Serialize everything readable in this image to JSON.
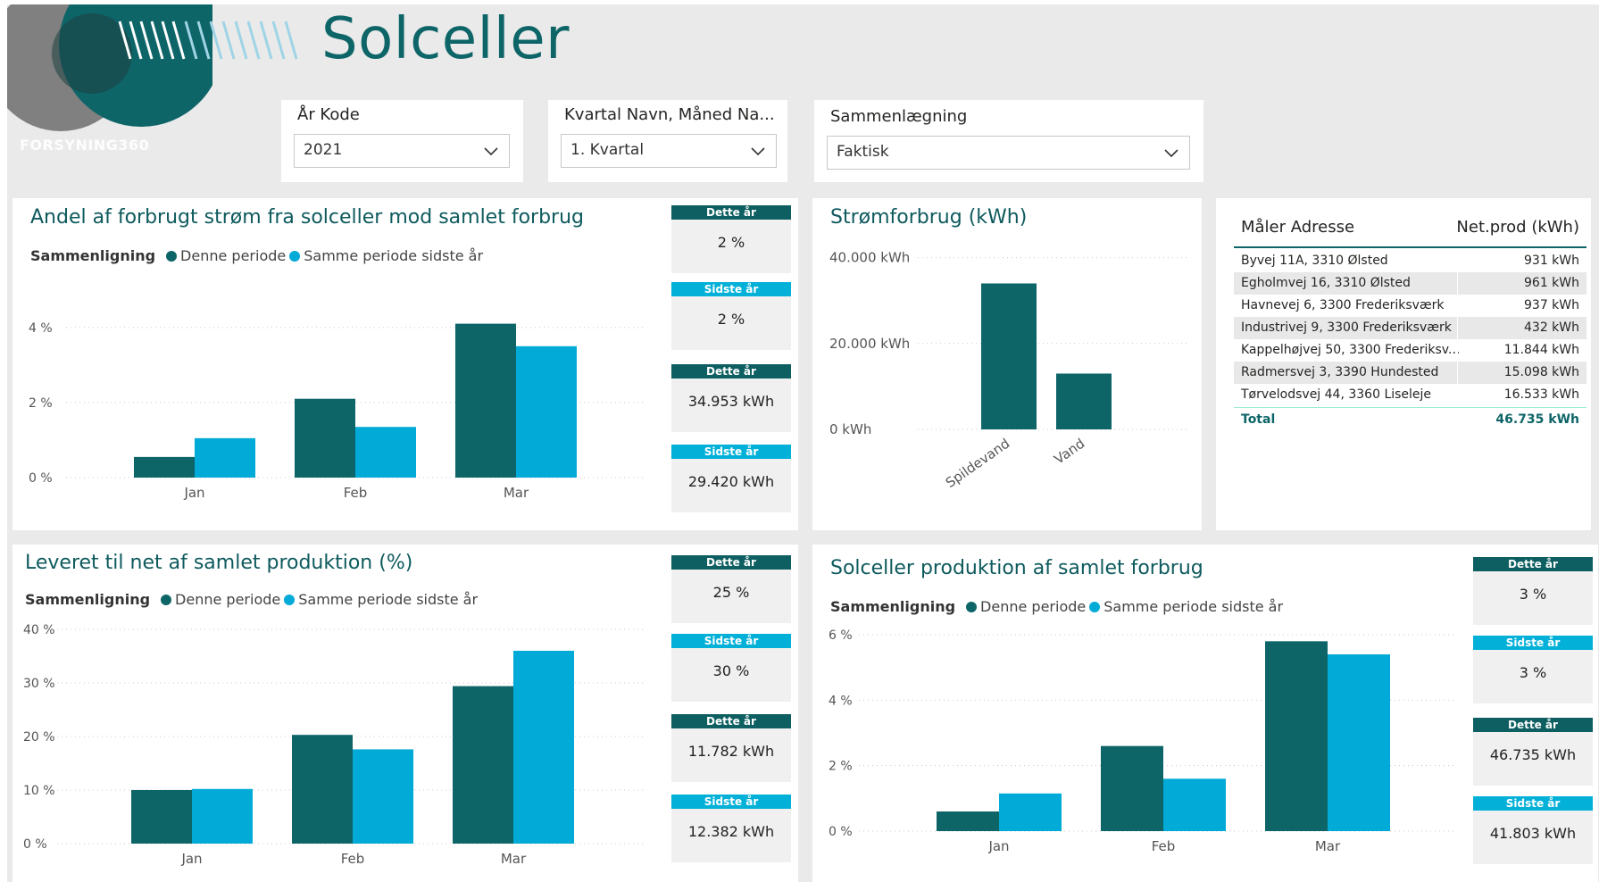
{
  "page": {
    "title": "Solceller",
    "logo_text": "FORSYNING360"
  },
  "colors": {
    "primary": "#0e6568",
    "secondary": "#01aad7",
    "kpi_dark": "#0e5f61",
    "kpi_light": "#02b0d8"
  },
  "slicers": [
    {
      "label": "År Kode",
      "value": "2021"
    },
    {
      "label": "Kvartal Navn, Måned Na...",
      "value": "1. Kvartal"
    },
    {
      "label": "Sammenlægning",
      "value": "Faktisk"
    }
  ],
  "legend": {
    "title": "Sammenligning",
    "this_period": "Denne periode",
    "last_year": "Samme periode sidste år"
  },
  "chart1": {
    "title": "Andel af forbrugt strøm fra solceller mod samlet forbrug",
    "chart_data": {
      "type": "bar",
      "categories": [
        "Jan",
        "Feb",
        "Mar"
      ],
      "series": [
        {
          "name": "Denne periode",
          "values": [
            0.55,
            2.1,
            4.1
          ]
        },
        {
          "name": "Samme periode sidste år",
          "values": [
            1.05,
            1.35,
            3.5
          ]
        }
      ],
      "ylim": [
        0,
        4.4
      ],
      "yticks": [
        "0 %",
        "2 %",
        "4 %"
      ],
      "ytick_values": [
        0,
        2,
        4
      ]
    },
    "kpis": [
      {
        "label": "Dette år",
        "value": "2 %"
      },
      {
        "label": "Sidste år",
        "value": "2 %"
      },
      {
        "label": "Dette år",
        "value": "34.953 kWh"
      },
      {
        "label": "Sidste år",
        "value": "29.420 kWh"
      }
    ]
  },
  "chart2": {
    "title": "Strømforbrug (kWh)",
    "chart_data": {
      "type": "bar",
      "categories": [
        "Spildevand",
        "Vand"
      ],
      "values": [
        34000,
        13000
      ],
      "ylim": [
        0,
        42000
      ],
      "yticks": [
        "0 kWh",
        "20.000 kWh",
        "40.000 kWh"
      ],
      "ytick_values": [
        0,
        20000,
        40000
      ]
    }
  },
  "table": {
    "col1": "Måler Adresse",
    "col2": "Net.prod (kWh)",
    "rows": [
      {
        "address": "Byvej 11A, 3310 Ølsted",
        "value": "931 kWh"
      },
      {
        "address": "Egholmvej 16, 3310 Ølsted",
        "value": "961 kWh"
      },
      {
        "address": "Havnevej 6, 3300 Frederiksværk",
        "value": "937 kWh"
      },
      {
        "address": "Industrivej 9, 3300 Frederiksværk",
        "value": "432 kWh"
      },
      {
        "address": "Kappelhøjvej 50, 3300 Frederiksv...",
        "value": "11.844 kWh"
      },
      {
        "address": "Radmersvej 3, 3390 Hundested",
        "value": "15.098 kWh"
      },
      {
        "address": "Tørvelodsvej 44, 3360 Liseleje",
        "value": "16.533 kWh"
      }
    ],
    "total_label": "Total",
    "total_value": "46.735 kWh"
  },
  "chart3": {
    "title": "Leveret til net af samlet produktion (%)",
    "chart_data": {
      "type": "bar",
      "categories": [
        "Jan",
        "Feb",
        "Mar"
      ],
      "series": [
        {
          "name": "Denne periode",
          "values": [
            10,
            20.3,
            29.4
          ]
        },
        {
          "name": "Samme periode sidste år",
          "values": [
            10.2,
            17.6,
            36
          ]
        }
      ],
      "ylim": [
        0,
        40
      ],
      "yticks": [
        "0 %",
        "10 %",
        "20 %",
        "30 %",
        "40 %"
      ],
      "ytick_values": [
        0,
        10,
        20,
        30,
        40
      ]
    },
    "kpis": [
      {
        "label": "Dette år",
        "value": "25 %"
      },
      {
        "label": "Sidste år",
        "value": "30 %"
      },
      {
        "label": "Dette år",
        "value": "11.782 kWh"
      },
      {
        "label": "Sidste år",
        "value": "12.382 kWh"
      }
    ]
  },
  "chart4": {
    "title": "Solceller produktion af samlet forbrug",
    "chart_data": {
      "type": "bar",
      "categories": [
        "Jan",
        "Feb",
        "Mar"
      ],
      "series": [
        {
          "name": "Denne periode",
          "values": [
            0.6,
            2.6,
            5.8
          ]
        },
        {
          "name": "Samme periode sidste år",
          "values": [
            1.15,
            1.6,
            5.4
          ]
        }
      ],
      "ylim": [
        0,
        6
      ],
      "yticks": [
        "0 %",
        "2 %",
        "4 %",
        "6 %"
      ],
      "ytick_values": [
        0,
        2,
        4,
        6
      ]
    },
    "kpis": [
      {
        "label": "Dette år",
        "value": "3 %"
      },
      {
        "label": "Sidste år",
        "value": "3 %"
      },
      {
        "label": "Dette år",
        "value": "46.735 kWh"
      },
      {
        "label": "Sidste år",
        "value": "41.803 kWh"
      }
    ]
  }
}
